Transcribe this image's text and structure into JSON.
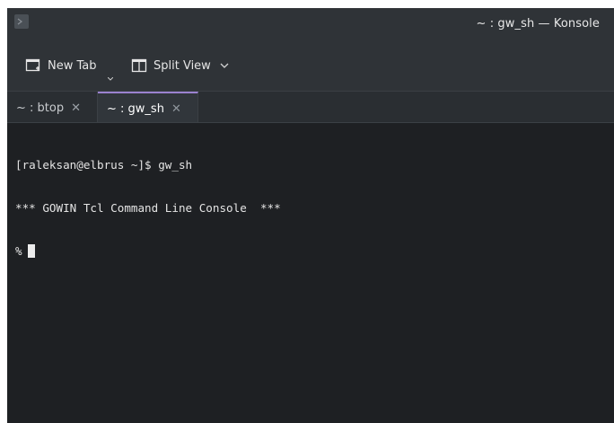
{
  "window": {
    "title": "~ : gw_sh — Konsole",
    "app_icon": "konsole-app-icon"
  },
  "toolbar": {
    "new_tab_label": "New Tab",
    "new_tab_icon": "new-tab-icon",
    "split_view_label": "Split View",
    "split_view_icon": "split-view-icon"
  },
  "tabs": [
    {
      "label": "~ : btop",
      "active": false
    },
    {
      "label": "~ : gw_sh",
      "active": true
    }
  ],
  "terminal": {
    "lines": [
      "[raleksan@elbrus ~]$ gw_sh",
      "*** GOWIN Tcl Command Line Console  ***",
      "%"
    ]
  },
  "colors": {
    "titlebar": "#2f3337",
    "terminal_bg": "#1e2023",
    "active_tab_accent": "#9b82cf",
    "text": "#e4e4e4"
  }
}
